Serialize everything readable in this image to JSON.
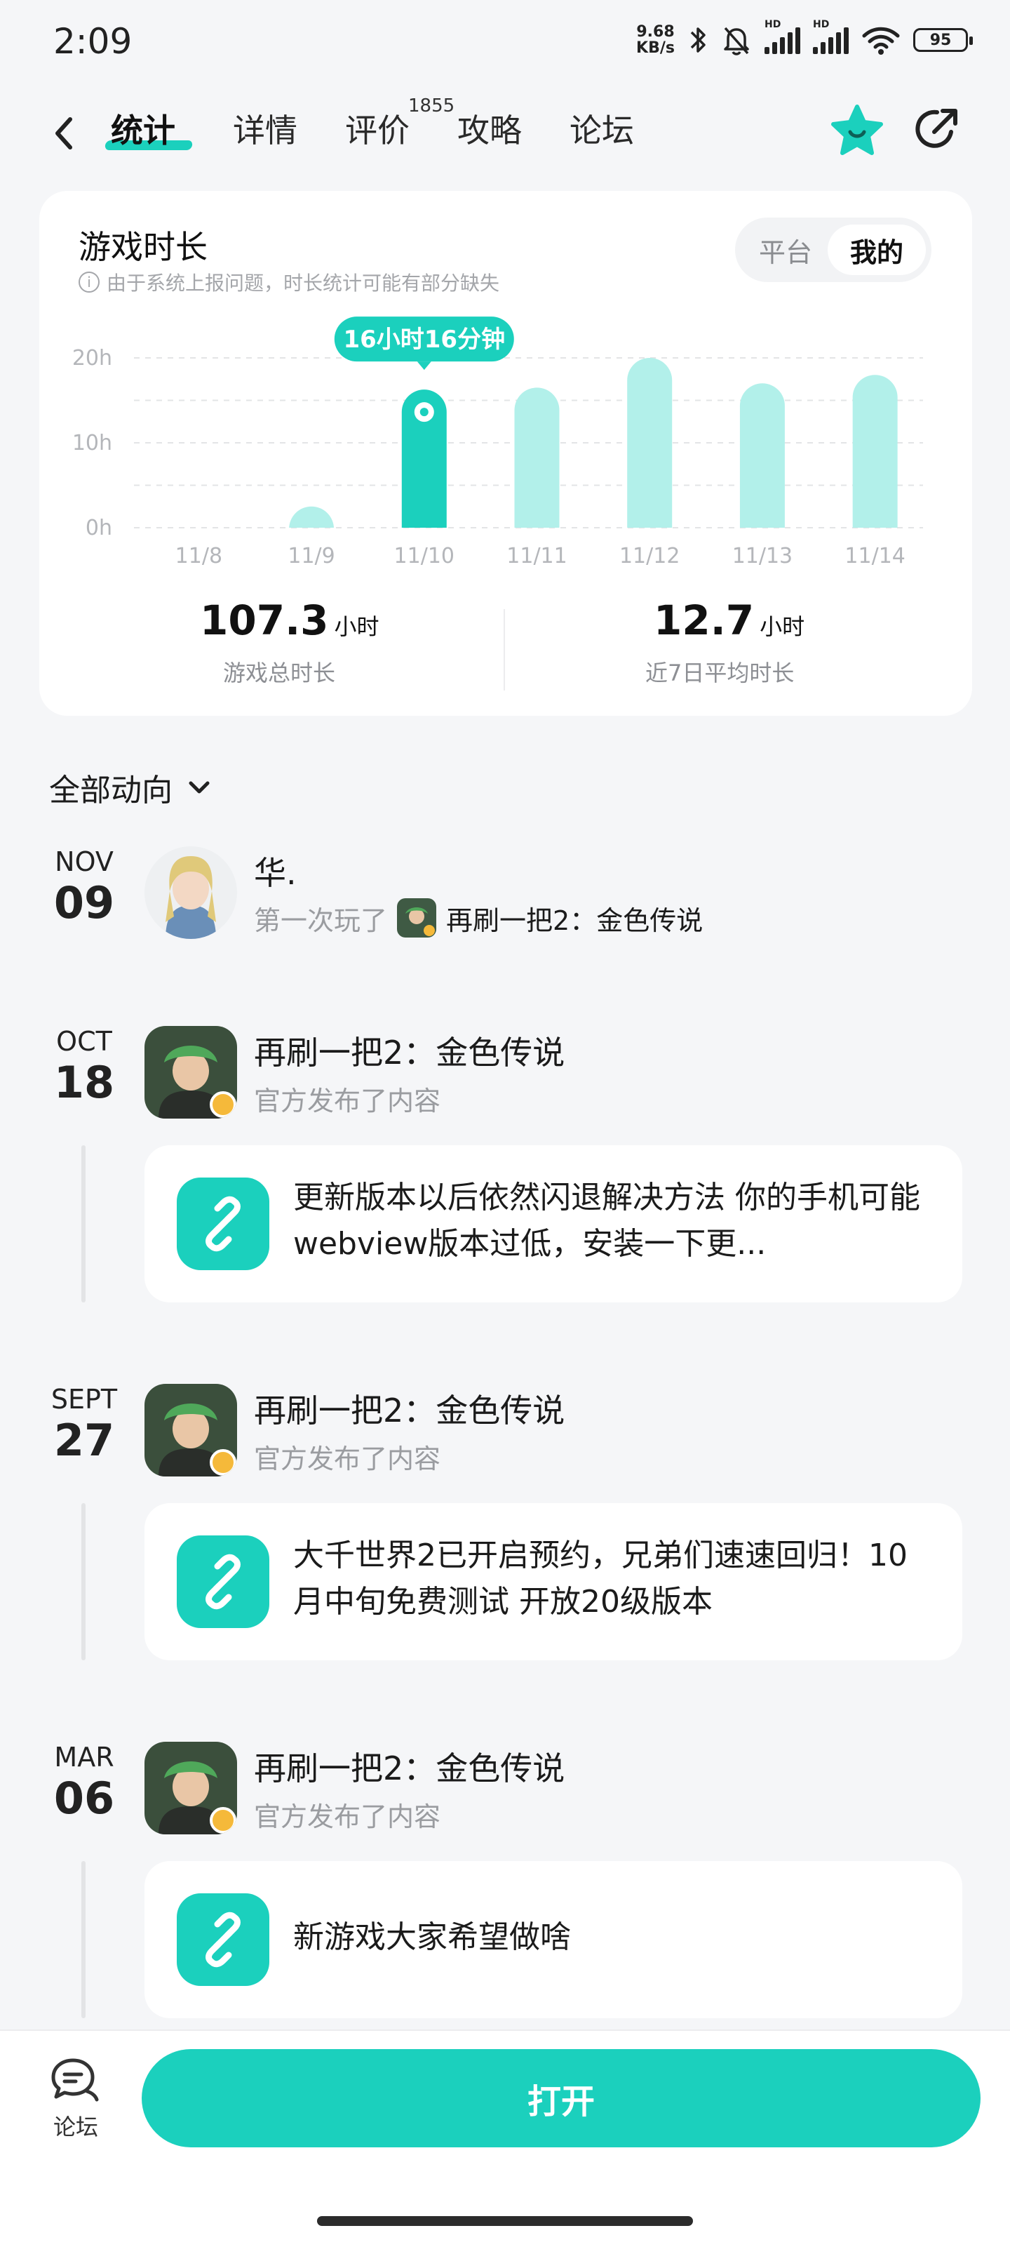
{
  "status_bar": {
    "time": "2:09",
    "net_speed_value": "9.68",
    "net_speed_unit": "KB/s",
    "battery": "95",
    "hd_label": "HD"
  },
  "nav": {
    "tabs": [
      {
        "label": "统计",
        "active": true
      },
      {
        "label": "详情"
      },
      {
        "label": "评价",
        "badge": "1855"
      },
      {
        "label": "攻略"
      },
      {
        "label": "论坛"
      }
    ]
  },
  "playtime_card": {
    "title": "游戏时长",
    "note": "由于系统上报问题，时长统计可能有部分缺失",
    "info_icon": "i",
    "segment": {
      "options": [
        "平台",
        "我的"
      ],
      "selected": "我的"
    },
    "tooltip": "16小时16分钟",
    "total": {
      "value": "107.3",
      "unit": "小时",
      "label": "游戏总时长"
    },
    "average": {
      "value": "12.7",
      "unit": "小时",
      "label": "近7日平均时长"
    }
  },
  "chart_data": {
    "type": "bar",
    "categories": [
      "11/8",
      "11/9",
      "11/10",
      "11/11",
      "11/12",
      "11/13",
      "11/14"
    ],
    "values": [
      0,
      2.5,
      16.27,
      16.5,
      20,
      17,
      18
    ],
    "highlight_index": 2,
    "yticks": [
      "20h",
      "10h",
      "0h"
    ],
    "ylim": [
      0,
      20
    ],
    "grid": true,
    "colors": {
      "bar": "#b2f0ea",
      "highlight": "#1bd0bd"
    }
  },
  "feed": {
    "filter_label": "全部动向",
    "items": [
      {
        "month": "NOV",
        "day": "09",
        "title": "华.",
        "sub_prefix": "第一次玩了",
        "game": "再刷一把2：金色传说"
      },
      {
        "month": "OCT",
        "day": "18",
        "title": "再刷一把2：金色传说",
        "sub": "官方发布了内容",
        "post": "更新版本以后依然闪退解决方法 你的手机可能webview版本过低，安装一下更..."
      },
      {
        "month": "SEPT",
        "day": "27",
        "title": "再刷一把2：金色传说",
        "sub": "官方发布了内容",
        "post": "大千世界2已开启预约，兄弟们速速回归！10月中旬免费测试 开放20级版本"
      },
      {
        "month": "MAR",
        "day": "06",
        "title": "再刷一把2：金色传说",
        "sub": "官方发布了内容",
        "post": "新游戏大家希望做啥"
      }
    ]
  },
  "bottom": {
    "forum_label": "论坛",
    "open_label": "打开"
  },
  "icons": [
    "back-arrow-icon",
    "star-face-icon",
    "share-icon",
    "chevron-down-icon",
    "link-icon",
    "forum-chat-icon",
    "bluetooth-icon",
    "mute-bell-icon",
    "wifi-icon"
  ],
  "colors": {
    "accent": "#1bd0bd",
    "accent_light": "#b2f0ea",
    "bg": "#f5f6f8"
  }
}
